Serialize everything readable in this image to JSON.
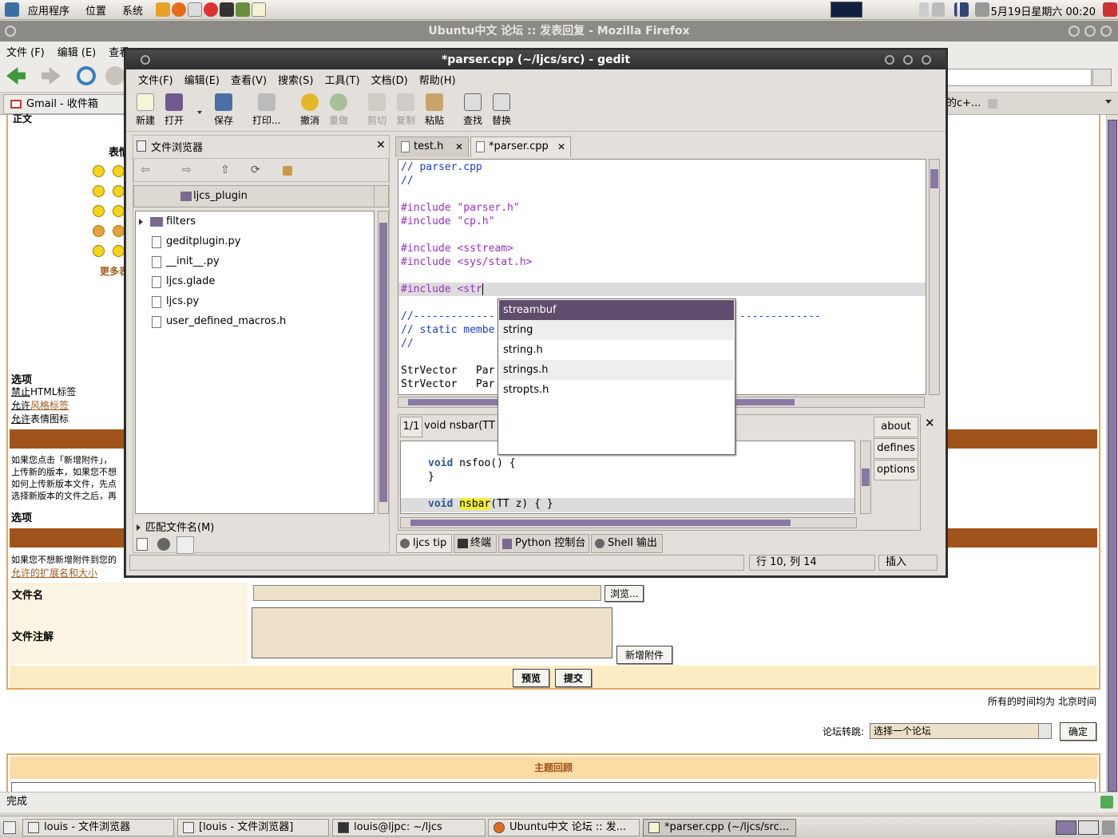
{
  "top_panel": {
    "menus": [
      "应用程序",
      "位置",
      "系统"
    ],
    "clock": "5月19日星期六 00:20"
  },
  "firefox": {
    "title": "Ubuntu中文 论坛 :: 发表回复 - Mozilla Firefox",
    "menu": [
      "文件 (F)",
      "编辑 (E)",
      "查看 (V)"
    ],
    "tabs": [
      "Gmail - 收件箱",
      "的c+..."
    ],
    "status": "完成",
    "page": {
      "body_label": "正文",
      "emoticon_label": "表情",
      "more_emoticons": "更多表",
      "options_header": "选项",
      "options": [
        "禁止HTML标签",
        "允许风格标签",
        "允许表情图标"
      ],
      "options_prefix": [
        "禁止",
        "允许",
        "允许"
      ],
      "options_suffix": [
        "HTML标签",
        "风格标签",
        "表情图标"
      ],
      "attach_text": [
        "如果您点击「新增附件」，",
        "上传新的版本，如果您不想",
        "如何上传新版本文件，先点",
        "选择新版本的文件之后，再"
      ],
      "options_header2": "选项",
      "attach_text2": "如果您不想新增附件到您的",
      "allowed_link": "允许的扩展名和大小",
      "filename_label": "文件名",
      "browse_button": "浏览...",
      "comment_label": "文件注解",
      "add_attachment": "新增附件",
      "preview": "预览",
      "submit": "提交",
      "timezone": "所有的时间均为 北京时间",
      "jump_label": "论坛转跳:",
      "jump_select": "选择一个论坛",
      "jump_ok": "确定",
      "topic_review": "主题回顾"
    }
  },
  "gedit": {
    "title": "*parser.cpp (~/ljcs/src) - gedit",
    "menu": [
      "文件(F)",
      "编辑(E)",
      "查看(V)",
      "搜索(S)",
      "工具(T)",
      "文档(D)",
      "帮助(H)"
    ],
    "toolbar": {
      "new": "新建",
      "open": "打开",
      "save": "保存",
      "print": "打印...",
      "undo": "撤消",
      "redo": "重做",
      "cut": "剪切",
      "copy": "复制",
      "paste": "粘贴",
      "find": "查找",
      "replace": "替换"
    },
    "side_panel": {
      "title": "文件浏览器",
      "location": "ljcs_plugin",
      "files": [
        "filters",
        "geditplugin.py",
        "__init__.py",
        "ljcs.glade",
        "ljcs.py",
        "user_defined_macros.h"
      ],
      "match_filename": "匹配文件名(M)"
    },
    "tabs": [
      "test.h",
      "*parser.cpp"
    ],
    "code": {
      "l1": "// parser.cpp",
      "l2": "//",
      "l3": "#include \"parser.h\"",
      "l4": "#include \"cp.h\"",
      "l5": "#include <sstream>",
      "l6": "#include <sys/stat.h>",
      "l7": "#include <str",
      "l8": "//-------------",
      "l8b": "-------------",
      "l9": "// static membe",
      "l10": "//",
      "l11": "StrVector   Par",
      "l12": "StrVector   Par"
    },
    "completion": [
      "streambuf",
      "string",
      "string.h",
      "strings.h",
      "stropts.h"
    ],
    "tip": {
      "counter": "1/1",
      "signature": "void nsbar(TT z",
      "line_a_kw": "void",
      "line_a": " nsfoo() {",
      "line_b": "}",
      "line_c_kw": "void",
      "line_c_fn": "nsbar",
      "line_c_rest": "(TT z) { }",
      "buttons": [
        "about",
        "defines",
        "options"
      ]
    },
    "bottom_tabs": [
      "ljcs tip",
      "终端",
      "Python 控制台",
      "Shell 输出"
    ],
    "status": {
      "position": "行 10, 列 14",
      "mode": "插入"
    }
  },
  "taskbar": [
    "louis - 文件浏览器",
    "[louis - 文件浏览器]",
    "louis@ljpc: ~/ljcs",
    "Ubuntu中文 论坛 :: 发...",
    "*parser.cpp (~/ljcs/src..."
  ],
  "colors": {
    "forum_orange": "#a0531b",
    "forum_cream": "#fbf4e2",
    "selection_purple": "#5f4b6b",
    "comment_blue": "#1a3fcf",
    "preproc_purple": "#9a2fc2"
  }
}
